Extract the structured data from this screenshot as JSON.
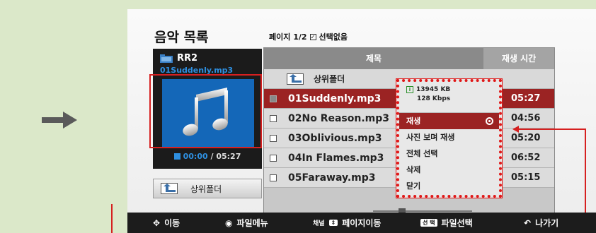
{
  "screen": {
    "title": "음악 목록",
    "page_info": "페이지 1/2",
    "select_none": "선택없음"
  },
  "info_panel": {
    "folder_name": "RR2",
    "current_file": "01Suddenly.mp3",
    "elapsed": "00:00",
    "total": "/ 05:27",
    "up_folder_label": "상위폴더"
  },
  "file_list": {
    "col_name": "제목",
    "col_time": "재생 시간",
    "up_folder_label": "상위폴더",
    "rows": [
      {
        "name": "01Suddenly.mp3",
        "time": "05:27"
      },
      {
        "name": "02No Reason.mp3",
        "time": "04:56"
      },
      {
        "name": "03Oblivious.mp3",
        "time": "05:20"
      },
      {
        "name": "04In Flames.mp3",
        "time": "06:52"
      },
      {
        "name": "05Faraway.mp3",
        "time": "05:15"
      }
    ]
  },
  "popup": {
    "size": "13945 KB",
    "bitrate": "128 Kbps",
    "items": [
      "재생",
      "사진 보며 재생",
      "전체 선택",
      "삭제",
      "닫기"
    ]
  },
  "navbar": {
    "move": "이동",
    "file_menu": "파일메뉴",
    "channel": "채널",
    "page_move": "페이지이동",
    "select_badge": "선 택",
    "file_select": "파일선택",
    "exit": "나가기"
  },
  "colors": {
    "background": "#dbe8c9",
    "highlight": "#9b2323",
    "annotation": "#d62020",
    "accent_blue": "#2e8fe0"
  }
}
